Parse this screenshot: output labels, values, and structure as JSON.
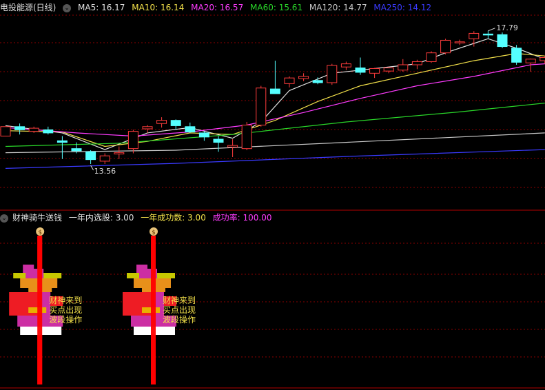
{
  "stock_name": "电投能源(日线)",
  "ma_labels": [
    {
      "text": "MA5: 16.17",
      "color": "#e0e0e0"
    },
    {
      "text": "MA10: 16.14",
      "color": "#f2e04a"
    },
    {
      "text": "MA20: 16.57",
      "color": "#ff3cff"
    },
    {
      "text": "MA60: 15.61",
      "color": "#29d629"
    },
    {
      "text": "MA120: 14.77",
      "color": "#c8c8c8"
    },
    {
      "text": "MA250: 14.12",
      "color": "#3a3aff"
    }
  ],
  "indicator": {
    "name": "财神骑牛送钱",
    "stats": [
      {
        "text": "一年内选股: 3.00",
        "color": "#e0e0e0"
      },
      {
        "text": "一年成功数: 3.00",
        "color": "#f2e04a"
      },
      {
        "text": "成功率: 100.00",
        "color": "#ff3cff"
      }
    ],
    "signal_text": [
      "财神来到",
      "买点出现",
      "波段操作"
    ],
    "coin_glyph": "$",
    "signal_x": [
      2,
      10
    ],
    "signal_colors": {
      "bar": "#ff0000",
      "text": "#f2e04a"
    }
  },
  "colors": {
    "up": "#ff3c3c",
    "down": "#54ffff",
    "grid": "#8b0000"
  },
  "chart_data": {
    "type": "candlestick",
    "price_range": [
      12.2,
      18.3
    ],
    "high_label": "17.79",
    "low_label": "13.56",
    "candles": [
      {
        "o": 14.45,
        "h": 14.75,
        "l": 14.5,
        "c": 14.75
      },
      {
        "o": 14.75,
        "h": 14.85,
        "l": 14.5,
        "c": 14.65
      },
      {
        "o": 14.6,
        "h": 14.75,
        "l": 14.55,
        "c": 14.7
      },
      {
        "o": 14.65,
        "h": 14.75,
        "l": 14.5,
        "c": 14.55
      },
      {
        "o": 14.3,
        "h": 14.45,
        "l": 13.72,
        "c": 14.25
      },
      {
        "o": 14.05,
        "h": 14.25,
        "l": 13.9,
        "c": 13.98
      },
      {
        "o": 13.95,
        "h": 14.0,
        "l": 13.56,
        "c": 13.7
      },
      {
        "o": 13.65,
        "h": 13.9,
        "l": 13.56,
        "c": 13.82
      },
      {
        "o": 13.88,
        "h": 14.12,
        "l": 13.72,
        "c": 13.92
      },
      {
        "o": 14.05,
        "h": 14.65,
        "l": 13.9,
        "c": 14.6
      },
      {
        "o": 14.68,
        "h": 14.8,
        "l": 14.55,
        "c": 14.75
      },
      {
        "o": 14.85,
        "h": 15.05,
        "l": 14.72,
        "c": 14.95
      },
      {
        "o": 14.95,
        "h": 14.98,
        "l": 14.65,
        "c": 14.78
      },
      {
        "o": 14.75,
        "h": 14.88,
        "l": 14.55,
        "c": 14.58
      },
      {
        "o": 14.55,
        "h": 14.6,
        "l": 14.3,
        "c": 14.42
      },
      {
        "o": 14.35,
        "h": 14.45,
        "l": 13.95,
        "c": 14.25
      },
      {
        "o": 14.1,
        "h": 14.35,
        "l": 13.78,
        "c": 14.15
      },
      {
        "o": 14.05,
        "h": 14.9,
        "l": 14.0,
        "c": 14.8
      },
      {
        "o": 14.8,
        "h": 16.05,
        "l": 14.75,
        "c": 15.98
      },
      {
        "o": 15.95,
        "h": 16.85,
        "l": 15.8,
        "c": 15.8
      },
      {
        "o": 16.12,
        "h": 16.35,
        "l": 16.0,
        "c": 16.3
      },
      {
        "o": 16.28,
        "h": 16.45,
        "l": 16.2,
        "c": 16.35
      },
      {
        "o": 16.22,
        "h": 16.32,
        "l": 16.1,
        "c": 16.15
      },
      {
        "o": 16.15,
        "h": 16.75,
        "l": 16.08,
        "c": 16.7
      },
      {
        "o": 16.65,
        "h": 16.82,
        "l": 16.55,
        "c": 16.75
      },
      {
        "o": 16.62,
        "h": 16.95,
        "l": 16.4,
        "c": 16.48
      },
      {
        "o": 16.45,
        "h": 16.62,
        "l": 16.3,
        "c": 16.6
      },
      {
        "o": 16.52,
        "h": 16.65,
        "l": 16.45,
        "c": 16.62
      },
      {
        "o": 16.55,
        "h": 16.9,
        "l": 16.5,
        "c": 16.72
      },
      {
        "o": 16.72,
        "h": 16.88,
        "l": 16.58,
        "c": 16.82
      },
      {
        "o": 16.82,
        "h": 17.15,
        "l": 16.78,
        "c": 17.1
      },
      {
        "o": 17.1,
        "h": 17.55,
        "l": 17.05,
        "c": 17.5
      },
      {
        "o": 17.42,
        "h": 17.52,
        "l": 17.35,
        "c": 17.45
      },
      {
        "o": 17.55,
        "h": 17.79,
        "l": 17.3,
        "c": 17.72
      },
      {
        "o": 17.7,
        "h": 17.8,
        "l": 17.55,
        "c": 17.68
      },
      {
        "o": 17.68,
        "h": 17.75,
        "l": 17.25,
        "c": 17.3
      },
      {
        "o": 17.25,
        "h": 17.35,
        "l": 16.72,
        "c": 16.8
      },
      {
        "o": 16.78,
        "h": 16.92,
        "l": 16.5,
        "c": 16.9
      },
      {
        "o": 16.85,
        "h": 17.0,
        "l": 16.75,
        "c": 16.95
      }
    ],
    "ma_series": [
      {
        "name": "MA5",
        "color": "#e0e0e0",
        "values": [
          [
            0,
            14.78
          ],
          [
            4,
            14.55
          ],
          [
            7,
            14.02
          ],
          [
            10,
            14.55
          ],
          [
            13,
            14.72
          ],
          [
            16,
            14.38
          ],
          [
            18,
            14.9
          ],
          [
            20,
            15.9
          ],
          [
            23,
            16.45
          ],
          [
            26,
            16.6
          ],
          [
            29,
            16.75
          ],
          [
            31,
            17.1
          ],
          [
            33,
            17.4
          ],
          [
            34,
            17.55
          ],
          [
            36,
            17.25
          ],
          [
            38,
            16.9
          ]
        ]
      },
      {
        "name": "MA10",
        "color": "#f2e04a",
        "values": [
          [
            0,
            14.62
          ],
          [
            4,
            14.58
          ],
          [
            7,
            14.12
          ],
          [
            10,
            14.28
          ],
          [
            13,
            14.55
          ],
          [
            16,
            14.5
          ],
          [
            19,
            14.95
          ],
          [
            22,
            15.55
          ],
          [
            25,
            16.05
          ],
          [
            29,
            16.45
          ],
          [
            33,
            16.85
          ],
          [
            36,
            17.08
          ],
          [
            38,
            17.0
          ]
        ]
      },
      {
        "name": "MA20",
        "color": "#ff3cff",
        "values": [
          [
            0,
            14.72
          ],
          [
            5,
            14.55
          ],
          [
            9,
            14.45
          ],
          [
            13,
            14.58
          ],
          [
            17,
            14.8
          ],
          [
            21,
            15.2
          ],
          [
            25,
            15.65
          ],
          [
            29,
            16.05
          ],
          [
            33,
            16.35
          ],
          [
            37,
            16.72
          ],
          [
            38,
            16.75
          ]
        ]
      },
      {
        "name": "MA60",
        "color": "#29d629",
        "values": [
          [
            0,
            14.12
          ],
          [
            8,
            14.22
          ],
          [
            16,
            14.5
          ],
          [
            24,
            14.9
          ],
          [
            32,
            15.22
          ],
          [
            38,
            15.5
          ]
        ]
      },
      {
        "name": "MA120",
        "color": "#c8c8c8",
        "values": [
          [
            0,
            13.92
          ],
          [
            12,
            14.0
          ],
          [
            24,
            14.25
          ],
          [
            38,
            14.55
          ]
        ]
      },
      {
        "name": "MA250",
        "color": "#3a3aff",
        "values": [
          [
            0,
            13.42
          ],
          [
            12,
            13.58
          ],
          [
            24,
            13.8
          ],
          [
            38,
            14.02
          ]
        ]
      }
    ]
  }
}
